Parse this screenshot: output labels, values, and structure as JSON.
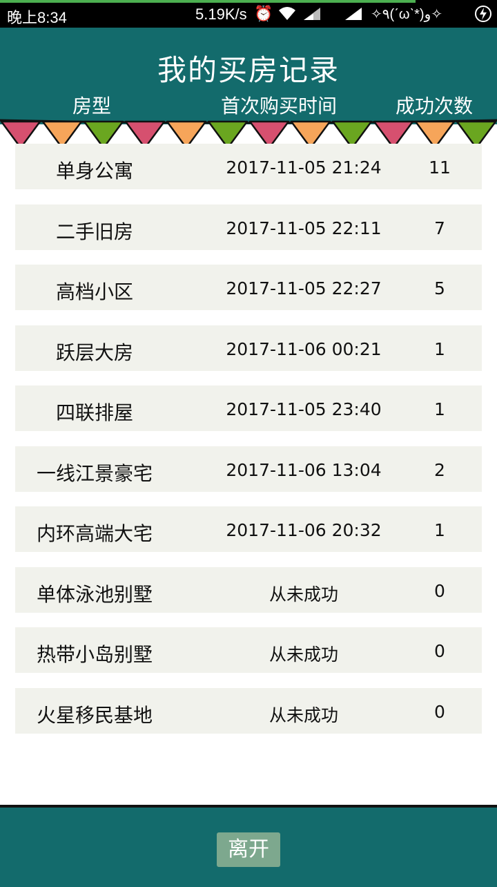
{
  "status_bar": {
    "time": "晚上8:34",
    "speed": "5.19K/s",
    "kaomoji": "✧٩(ˊωˋ*)و✧"
  },
  "header": {
    "title": "我的买房记录",
    "columns": [
      "房型",
      "首次购买时间",
      "成功次数"
    ]
  },
  "records": [
    {
      "name": "单身公寓",
      "time": "2017-11-05 21:24",
      "count": "11"
    },
    {
      "name": "二手旧房",
      "time": "2017-11-05 22:11",
      "count": "7"
    },
    {
      "name": "高档小区",
      "time": "2017-11-05 22:27",
      "count": "5"
    },
    {
      "name": "跃层大房",
      "time": "2017-11-06 00:21",
      "count": "1"
    },
    {
      "name": "四联排屋",
      "time": "2017-11-05 23:40",
      "count": "1"
    },
    {
      "name": "一线江景豪宅",
      "time": "2017-11-06 13:04",
      "count": "2"
    },
    {
      "name": "内环高端大宅",
      "time": "2017-11-06 20:32",
      "count": "1"
    },
    {
      "name": "单体泳池别墅",
      "time": "从未成功",
      "count": "0"
    },
    {
      "name": "热带小岛别墅",
      "time": "从未成功",
      "count": "0"
    },
    {
      "name": "火星移民基地",
      "time": "从未成功",
      "count": "0"
    }
  ],
  "footer": {
    "leave_label": "离开"
  },
  "colors": {
    "header_bg": "#136b6c",
    "row_bg": "#f1f2ec",
    "button_bg": "#7da88e",
    "flag_pink": "#d6506f",
    "flag_orange": "#f6a55a",
    "flag_green": "#6aa620"
  }
}
